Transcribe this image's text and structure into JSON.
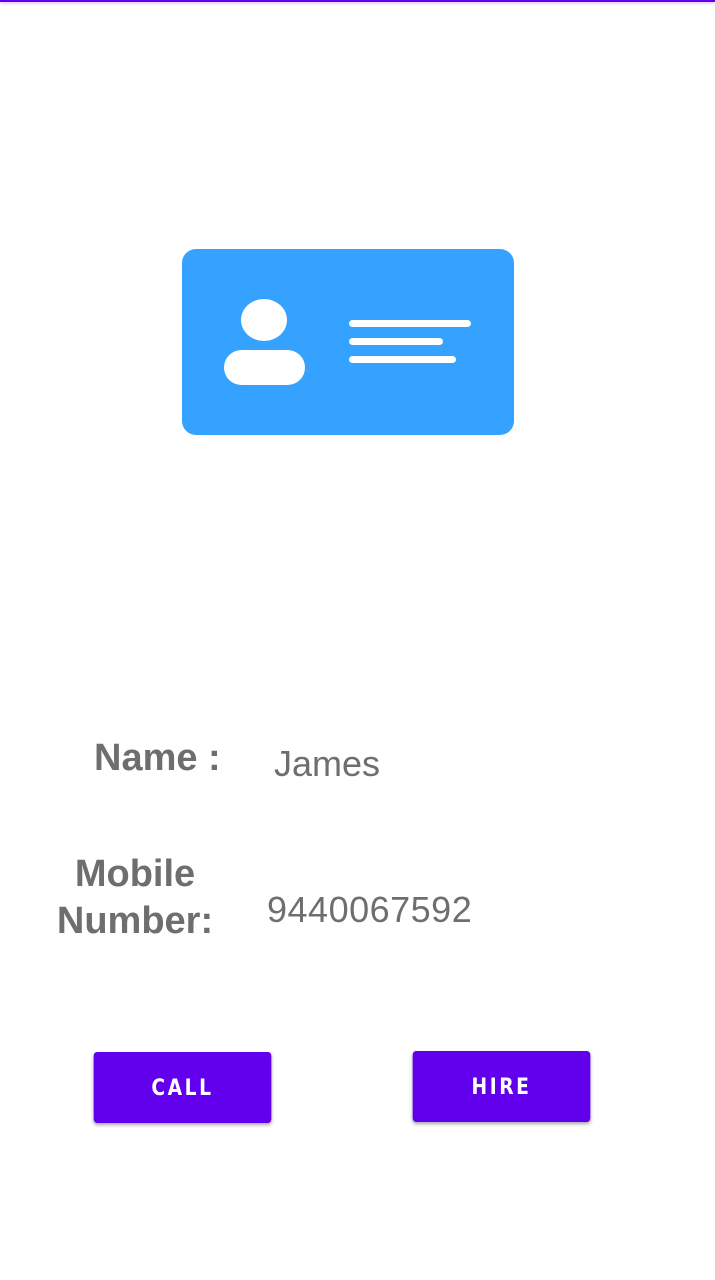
{
  "colors": {
    "accent": "#6200ee",
    "card": "#36a2ff",
    "text": "#6e6e6e",
    "background": "#ffffff"
  },
  "illustration": {
    "icon": "id-card-icon"
  },
  "details": {
    "name_label": "Name :",
    "name_value": "James",
    "mobile_label": "Mobile Number:",
    "mobile_value": "9440067592"
  },
  "actions": {
    "call_label": "CALL",
    "hire_label": "HIRE"
  }
}
